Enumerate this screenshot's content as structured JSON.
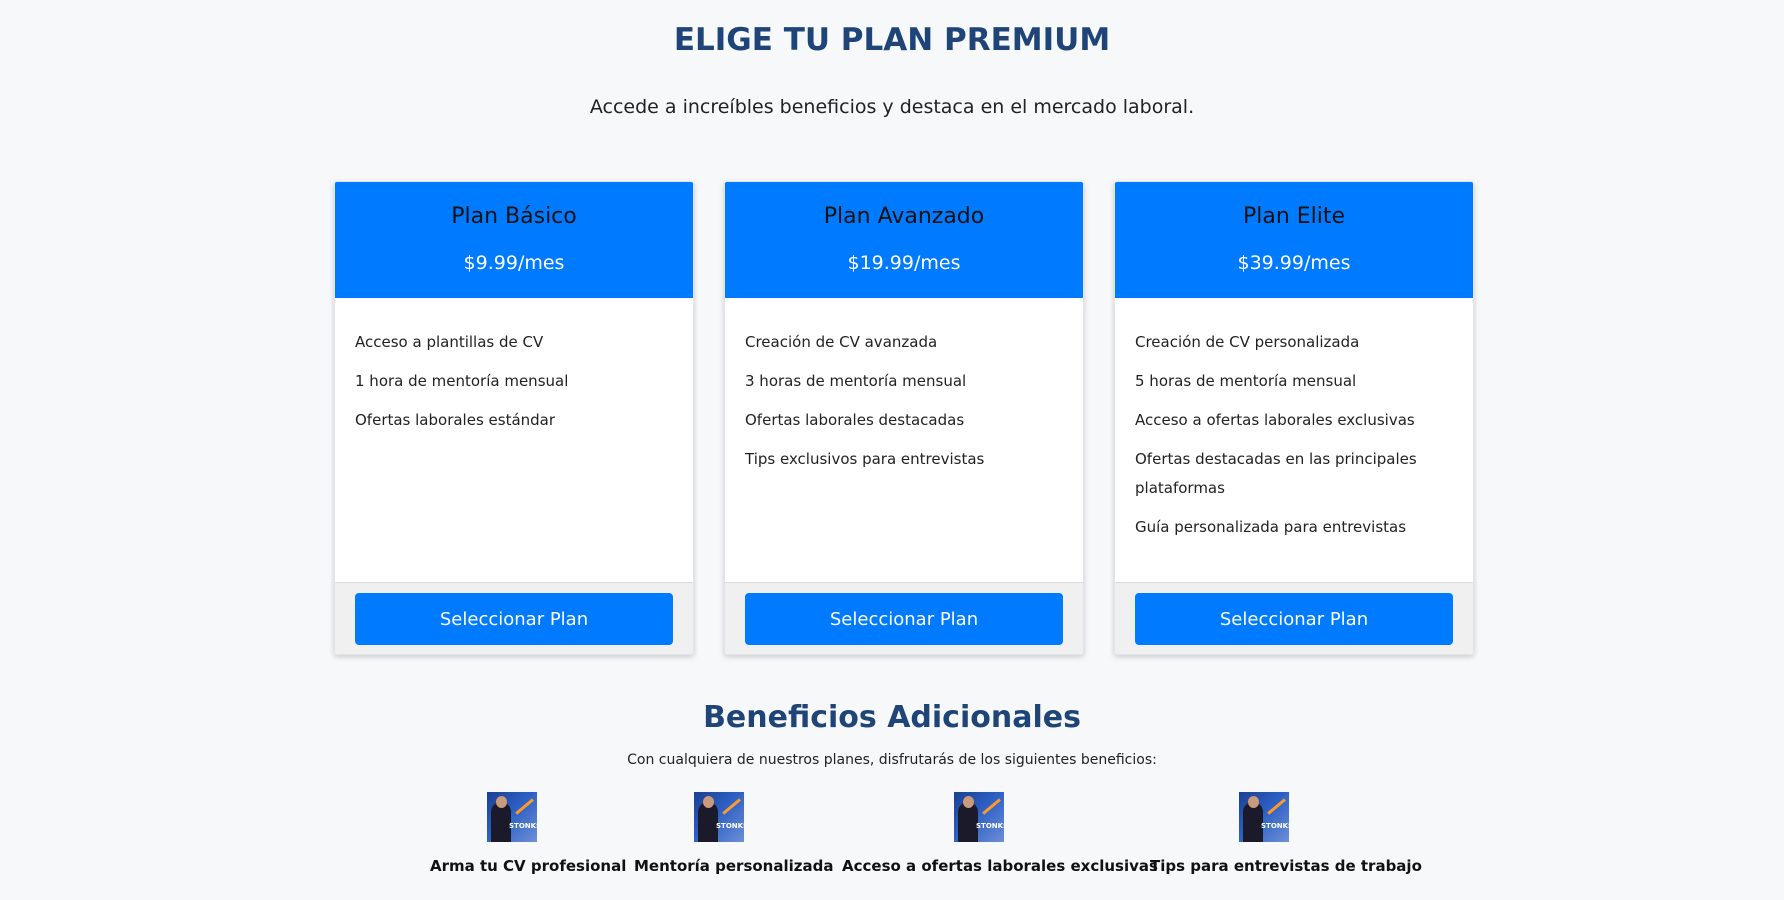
{
  "header": {
    "title": "ELIGE TU PLAN PREMIUM",
    "subtitle": "Accede a increíbles beneficios y destaca en el mercado laboral."
  },
  "plans": [
    {
      "name": "Plan Básico",
      "price": "$9.99/mes",
      "features": [
        "Acceso a plantillas de CV",
        "1 hora de mentoría mensual",
        "Ofertas laborales estándar"
      ],
      "button_label": "Seleccionar Plan"
    },
    {
      "name": "Plan Avanzado",
      "price": "$19.99/mes",
      "features": [
        "Creación de CV avanzada",
        "3 horas de mentoría mensual",
        "Ofertas laborales destacadas",
        "Tips exclusivos para entrevistas"
      ],
      "button_label": "Seleccionar Plan"
    },
    {
      "name": "Plan Elite",
      "price": "$39.99/mes",
      "features": [
        "Creación de CV personalizada",
        "5 horas de mentoría mensual",
        "Acceso a ofertas laborales exclusivas",
        "Ofertas destacadas en las principales plataformas",
        "Guía personalizada para entrevistas"
      ],
      "button_label": "Seleccionar Plan"
    }
  ],
  "benefits": {
    "title": "Beneficios Adicionales",
    "subtitle": "Con cualquiera de nuestros planes, disfrutarás de los siguientes beneficios:",
    "image_text": "STONKS",
    "items": [
      {
        "label": "Arma tu CV profesional"
      },
      {
        "label": "Mentoría personalizada"
      },
      {
        "label": "Acceso a ofertas laborales exclusivas"
      },
      {
        "label": "Tips para entrevistas de trabajo"
      }
    ]
  },
  "colors": {
    "accent": "#007bff",
    "heading": "#1e4478",
    "background": "#f7f8fa",
    "card_footer": "#f0f0f0"
  }
}
